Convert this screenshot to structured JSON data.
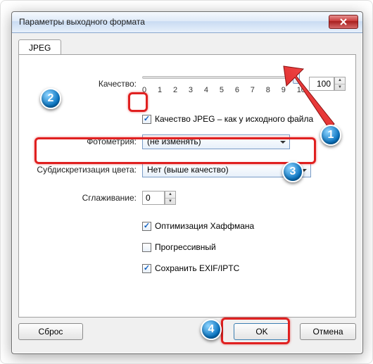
{
  "window": {
    "title": "Параметры выходного формата"
  },
  "tab": {
    "label": "JPEG"
  },
  "quality": {
    "label": "Качество:",
    "value": "100",
    "ticks": [
      "0",
      "1",
      "2",
      "3",
      "4",
      "5",
      "6",
      "7",
      "8",
      "9",
      "10"
    ]
  },
  "chkSameAsSource": {
    "label": "Качество JPEG – как у исходного файла"
  },
  "photometry": {
    "label": "Фотометрия:",
    "value": "(не изменять)"
  },
  "subsampling": {
    "label": "Субдискретизация цвета:",
    "value": "Нет (выше качество)"
  },
  "smoothing": {
    "label": "Сглаживание:",
    "value": "0"
  },
  "chkHuffman": {
    "label": "Оптимизация Хаффмана"
  },
  "chkProgressive": {
    "label": "Прогрессивный"
  },
  "chkExif": {
    "label": "Сохранить EXIF/IPTC"
  },
  "buttons": {
    "reset": "Сброс",
    "ok": "OK",
    "cancel": "Отмена"
  },
  "annotations": {
    "n1": "1",
    "n2": "2",
    "n3": "3",
    "n4": "4"
  }
}
